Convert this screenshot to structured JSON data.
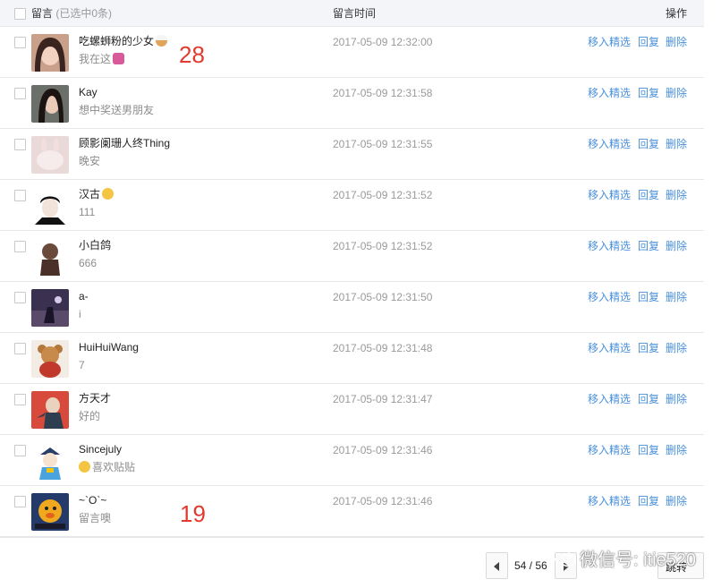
{
  "header": {
    "message_col": "留言",
    "selected_text": "(已选中0条)",
    "time_col": "留言时间",
    "ops_col": "操作"
  },
  "actions": {
    "feature": "移入精选",
    "reply": "回复",
    "delete": "删除"
  },
  "rows": [
    {
      "nick": "吃螺蛳粉的少女",
      "nick_emoji": "bowl",
      "content": "我在这",
      "content_emoji": "hand",
      "time": "2017-05-09 12:32:00"
    },
    {
      "nick": "Kay",
      "content": "想中奖送男朋友",
      "time": "2017-05-09 12:31:58"
    },
    {
      "nick": "顾影阑珊人终Thing",
      "content": "晚安",
      "time": "2017-05-09 12:31:55"
    },
    {
      "nick": "汉古",
      "nick_emoji": "shy",
      "content": "111",
      "time": "2017-05-09 12:31:52"
    },
    {
      "nick": "小白鸽",
      "content": "666",
      "time": "2017-05-09 12:31:52"
    },
    {
      "nick": "a-",
      "content": "i",
      "time": "2017-05-09 12:31:50"
    },
    {
      "nick": "HuiHuiWang",
      "content": "7",
      "time": "2017-05-09 12:31:48"
    },
    {
      "nick": "方天才",
      "content": "好的",
      "time": "2017-05-09 12:31:47"
    },
    {
      "nick": "Sincejuly",
      "content": "喜欢贴贴",
      "content_emoji_prefix": "smile",
      "time": "2017-05-09 12:31:46"
    },
    {
      "nick": "~`O`~",
      "content": "留言噢",
      "time": "2017-05-09 12:31:46"
    }
  ],
  "annotations": {
    "top": "28",
    "bottom": "19",
    "color": "#e23a2e"
  },
  "pagination": {
    "text": "54 / 56",
    "jump": "跳转"
  },
  "watermark": {
    "text": "微信号: itie520"
  },
  "colors": {
    "link": "#4a90d9",
    "header_bg": "#f4f5f9",
    "muted": "#9a9a9a"
  }
}
